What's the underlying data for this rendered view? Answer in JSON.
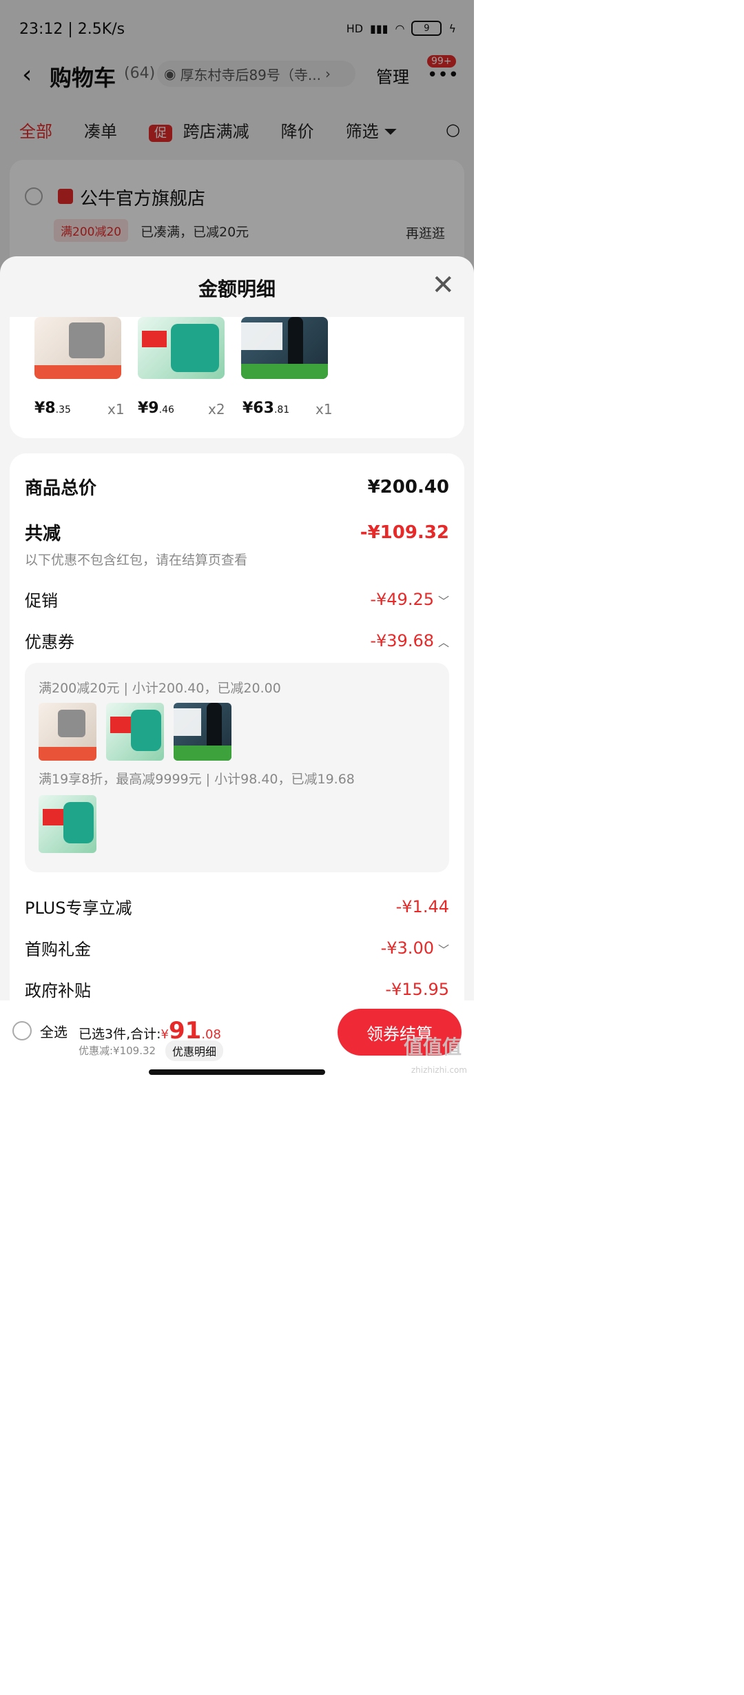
{
  "status": {
    "time_speed": "23:12 | 2.5K/s",
    "network": "HD",
    "battery": "9"
  },
  "header": {
    "back_icon": "‹",
    "title": "购物车",
    "count": "(64)",
    "address": "厚东村寺后89号（寺...",
    "manage": "管理",
    "badge": "99+"
  },
  "tabs": [
    {
      "label": "全部"
    },
    {
      "label": "凑单"
    },
    {
      "label": "跨店满减",
      "pill": "促"
    },
    {
      "label": "降价"
    },
    {
      "label": "筛选"
    }
  ],
  "store": {
    "name": "公牛官方旗舰店",
    "promo_tag": "满200减20",
    "promo_note": "已凑满，已减20元",
    "more": "再逛逛"
  },
  "sheet": {
    "title": "金额明细",
    "products": [
      {
        "price_int": "¥8",
        "price_dec": ".35",
        "qty": "x1"
      },
      {
        "price_int": "¥9",
        "price_dec": ".46",
        "qty": "x2"
      },
      {
        "price_int": "¥63",
        "price_dec": ".81",
        "qty": "x1"
      }
    ],
    "total_label": "商品总价",
    "total_value": "¥200.40",
    "reduce_label": "共减",
    "reduce_value": "-¥109.32",
    "reduce_note": "以下优惠不包含红包，请在结算页查看",
    "promo_label": "促销",
    "promo_value": "-¥49.25",
    "coupon_label": "优惠券",
    "coupon_value": "-¥39.68",
    "coupon_line1": "满200减20元 | 小计200.40，已减20.00",
    "coupon_line2": "满19享8折，最高减9999元 | 小计98.40，已减19.68",
    "plus_label": "PLUS专享立减",
    "plus_value": "-¥1.44",
    "first_label": "首购礼金",
    "first_value": "-¥3.00",
    "gov_label": "政府补贴",
    "gov_value": "-¥15.95"
  },
  "bottom": {
    "select_all": "全选",
    "selected": "已选3件,合计:",
    "yen": "¥",
    "total_int": "91",
    "total_dec": ".08",
    "saved": "优惠减:¥109.32",
    "detail_btn": "优惠明细",
    "checkout": "领券结算"
  },
  "watermark": {
    "logo": "值值值",
    "url": "zhizhizhi.com"
  }
}
